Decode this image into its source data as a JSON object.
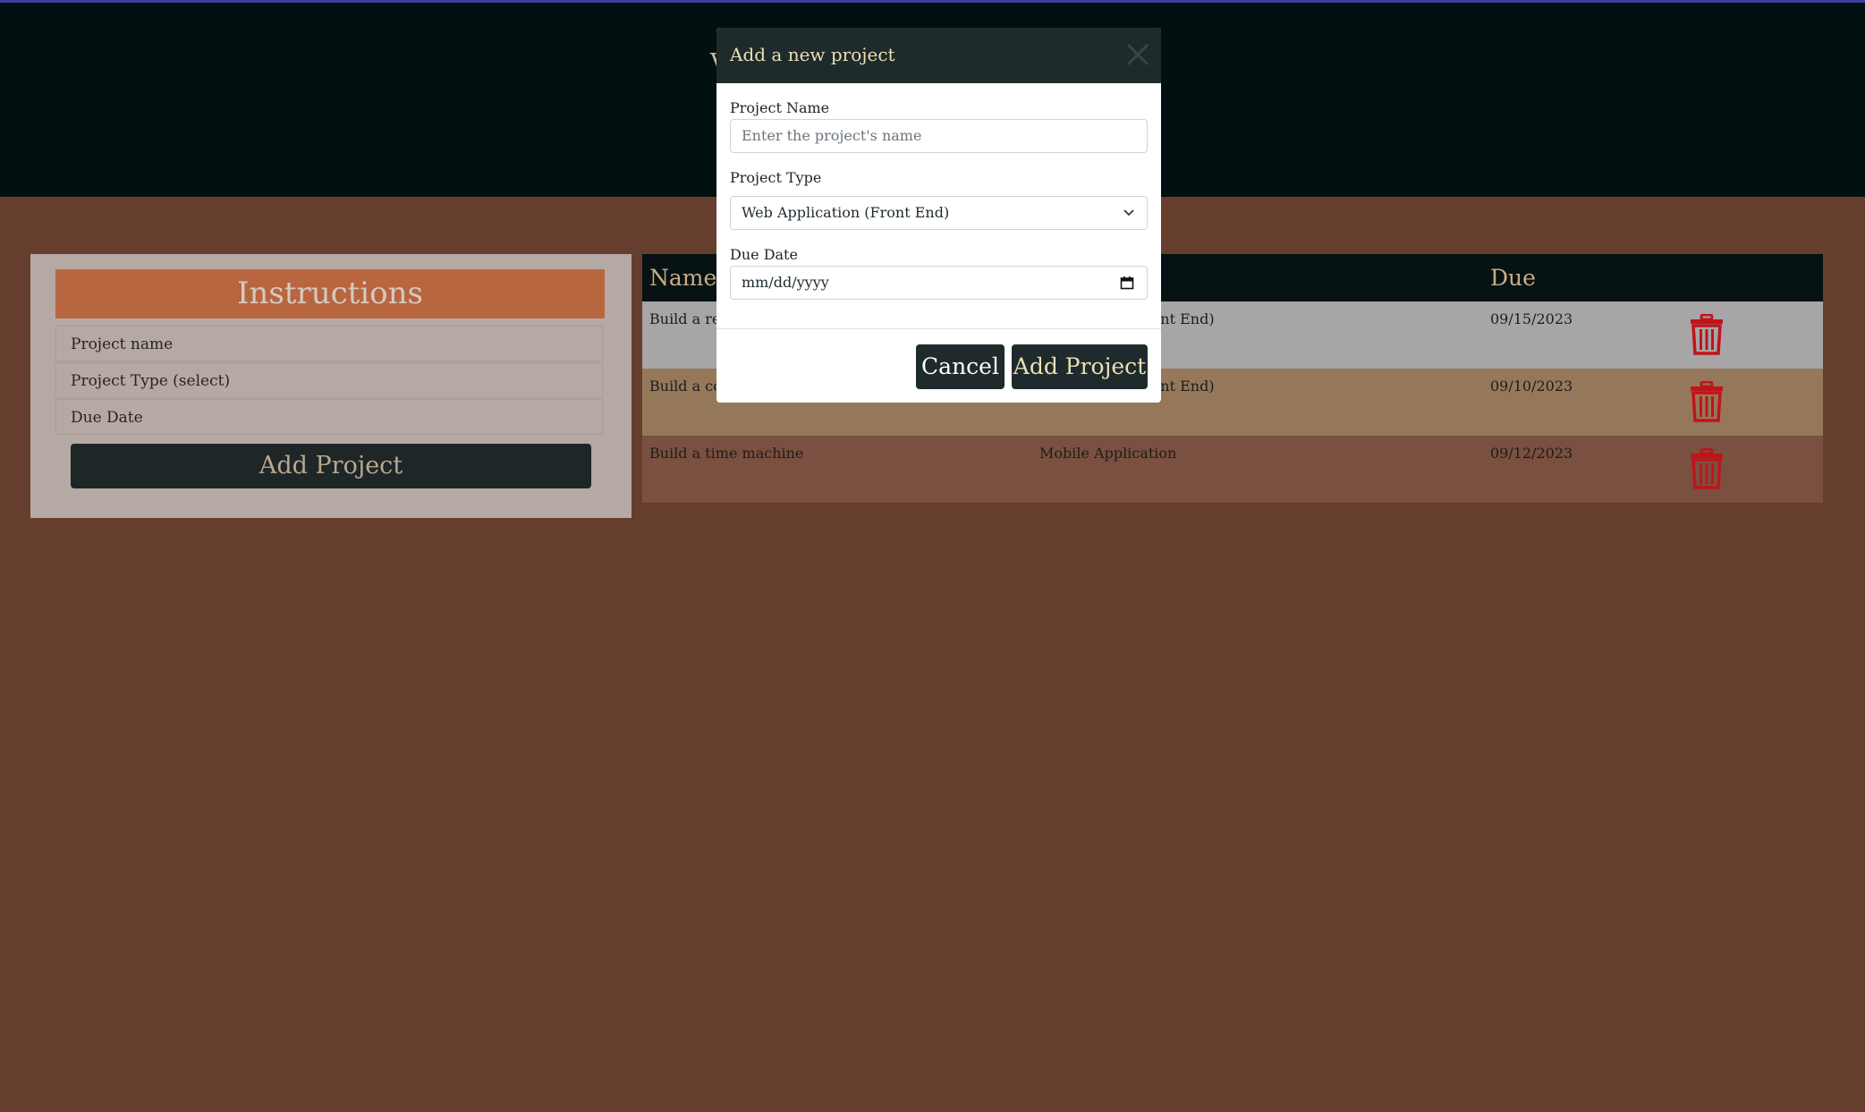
{
  "header": {
    "peek_text": "V"
  },
  "instructions": {
    "title": "Instructions",
    "items": [
      "Project name",
      "Project Type (select)",
      "Due Date"
    ],
    "button_label": "Add Project"
  },
  "table": {
    "headers": [
      "Name",
      "Due"
    ],
    "rows": [
      {
        "name": "Build a rea",
        "type": "ront End)",
        "due": "09/15/2023"
      },
      {
        "name": "Build a col",
        "type": "ront End)",
        "due": "09/10/2023"
      },
      {
        "name": "Build a time machine",
        "type": "Mobile Application",
        "due": "09/12/2023"
      }
    ],
    "delete_icon_color": "#c0141a"
  },
  "modal": {
    "title": "Add a new project",
    "project_name_label": "Project Name",
    "project_name_placeholder": "Enter the project's name",
    "project_type_label": "Project Type",
    "project_type_value": "Web Application (Front End)",
    "due_date_label": "Due Date",
    "due_date_placeholder": "mm/dd/yyyy",
    "cancel_label": "Cancel",
    "add_label": "Add Project"
  }
}
